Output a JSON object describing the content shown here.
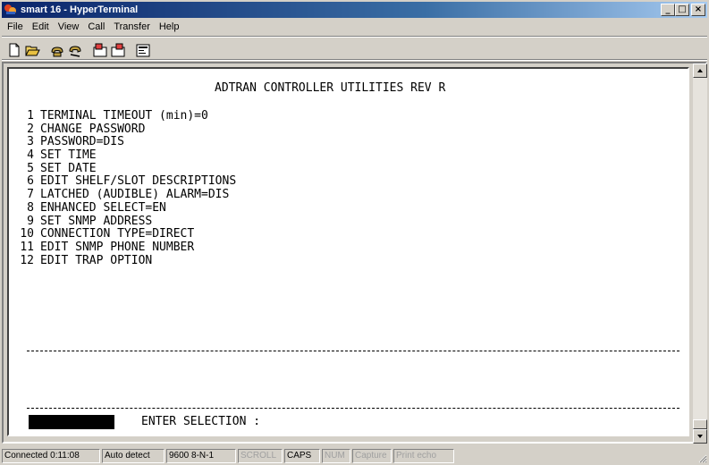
{
  "window": {
    "title": "smart 16 - HyperTerminal",
    "controls": [
      "_",
      "□",
      "×"
    ]
  },
  "menubar": {
    "items": [
      "File",
      "Edit",
      "View",
      "Call",
      "Transfer",
      "Help"
    ]
  },
  "toolbar": {
    "icons": [
      "new-icon",
      "open-icon",
      "connect-icon",
      "disconnect-icon",
      "send-icon",
      "receive-icon",
      "properties-icon"
    ]
  },
  "terminal": {
    "header": "ADTRAN CONTROLLER UTILITIES REV R",
    "options": [
      {
        "num": "1",
        "text": "TERMINAL TIMEOUT (min)=0"
      },
      {
        "num": "2",
        "text": "CHANGE PASSWORD"
      },
      {
        "num": "3",
        "text": "PASSWORD=DIS"
      },
      {
        "num": "4",
        "text": "SET TIME"
      },
      {
        "num": "5",
        "text": "SET DATE"
      },
      {
        "num": "6",
        "text": "EDIT SHELF/SLOT DESCRIPTIONS"
      },
      {
        "num": "7",
        "text": "LATCHED (AUDIBLE) ALARM=DIS"
      },
      {
        "num": "8",
        "text": "ENHANCED SELECT=EN"
      },
      {
        "num": "9",
        "text": "SET SNMP ADDRESS"
      },
      {
        "num": "10",
        "text": "CONNECTION TYPE=DIRECT"
      },
      {
        "num": "11",
        "text": "EDIT SNMP PHONE NUMBER"
      },
      {
        "num": "12",
        "text": "EDIT TRAP OPTION"
      }
    ],
    "prompt": "ENTER SELECTION :"
  },
  "statusbar": {
    "connected": "Connected 0:11:08",
    "detect": "Auto detect",
    "settings": "9600 8-N-1",
    "scroll": "SCROLL",
    "caps": "CAPS",
    "num": "NUM",
    "capture": "Capture",
    "print_echo": "Print echo"
  },
  "colors": {
    "title_start": "#0a246a",
    "title_end": "#a6caf0",
    "chrome": "#d4d0c8",
    "terminal_bg": "#ffffff"
  }
}
